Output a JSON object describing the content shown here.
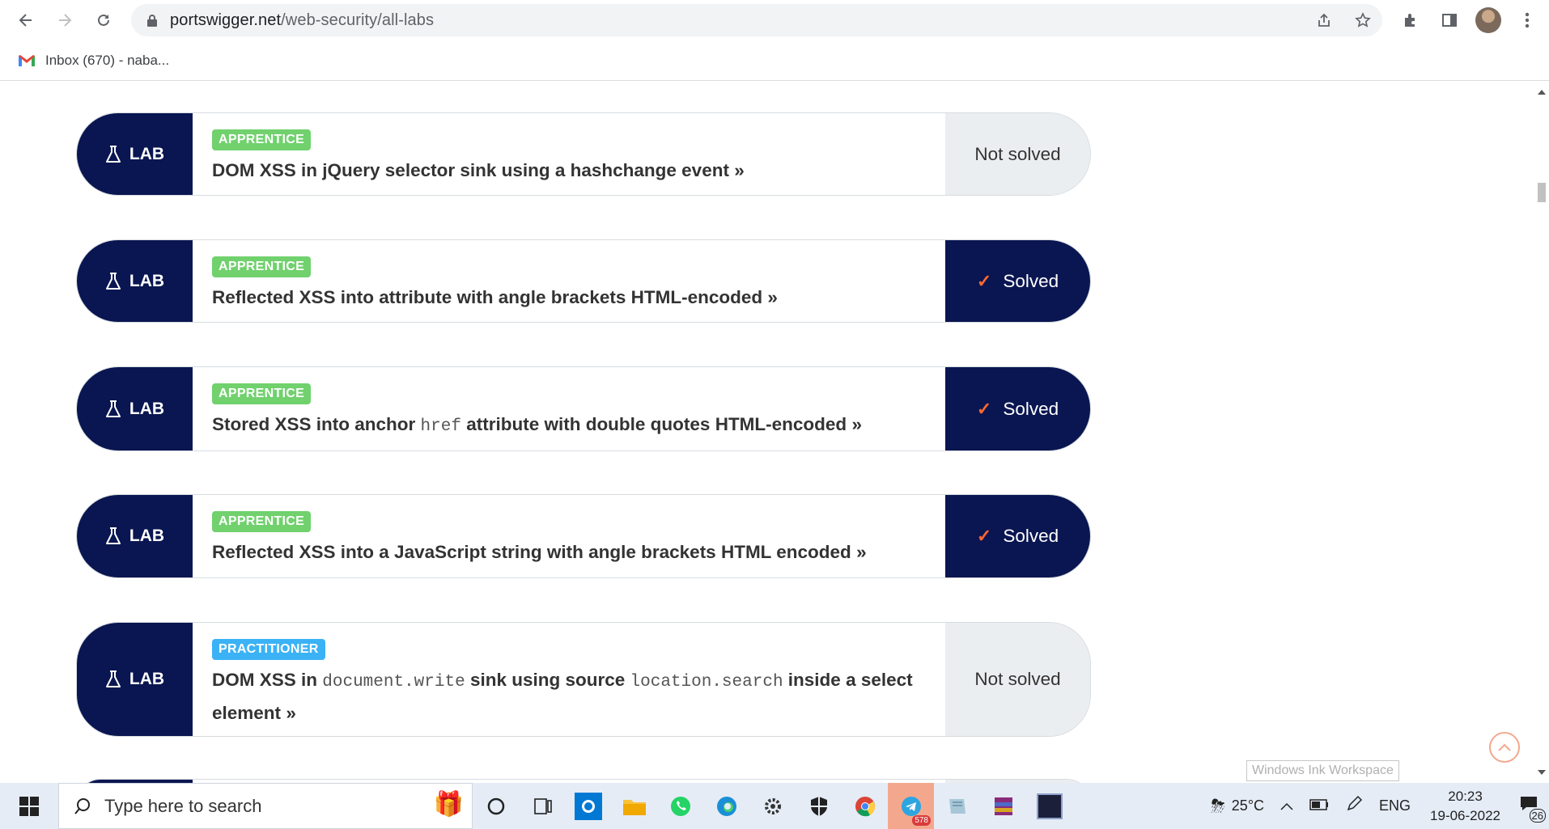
{
  "browser": {
    "url_domain": "portswigger.net",
    "url_path": "/web-security/all-labs",
    "bookmark_label": "Inbox (670) - naba..."
  },
  "labs": [
    {
      "tag": "LAB",
      "level": "APPRENTICE",
      "title_parts": [
        {
          "t": "DOM XSS in jQuery selector sink using a hashchange event",
          "code": false
        }
      ],
      "status": "Not solved",
      "solved": false
    },
    {
      "tag": "LAB",
      "level": "APPRENTICE",
      "title_parts": [
        {
          "t": "Reflected XSS into attribute with angle brackets HTML-encoded",
          "code": false
        }
      ],
      "status": "Solved",
      "solved": true
    },
    {
      "tag": "LAB",
      "level": "APPRENTICE",
      "title_parts": [
        {
          "t": "Stored XSS into anchor ",
          "code": false
        },
        {
          "t": "href",
          "code": true
        },
        {
          "t": " attribute with double quotes HTML-encoded",
          "code": false
        }
      ],
      "status": "Solved",
      "solved": true
    },
    {
      "tag": "LAB",
      "level": "APPRENTICE",
      "title_parts": [
        {
          "t": "Reflected XSS into a JavaScript string with angle brackets HTML encoded",
          "code": false
        }
      ],
      "status": "Solved",
      "solved": true
    },
    {
      "tag": "LAB",
      "level": "PRACTITIONER",
      "title_parts": [
        {
          "t": "DOM XSS in ",
          "code": false
        },
        {
          "t": "document.write",
          "code": true
        },
        {
          "t": " sink using source ",
          "code": false
        },
        {
          "t": "location.search",
          "code": true
        },
        {
          "t": " inside a select element",
          "code": false
        }
      ],
      "status": "Not solved",
      "solved": false
    }
  ],
  "tooltip": "Windows Ink Workspace",
  "taskbar": {
    "search_placeholder": "Type here to search",
    "weather": "25°C",
    "lang": "ENG",
    "time": "20:23",
    "date": "19-06-2022",
    "telegram_badge": "578",
    "notif_count": "26"
  }
}
